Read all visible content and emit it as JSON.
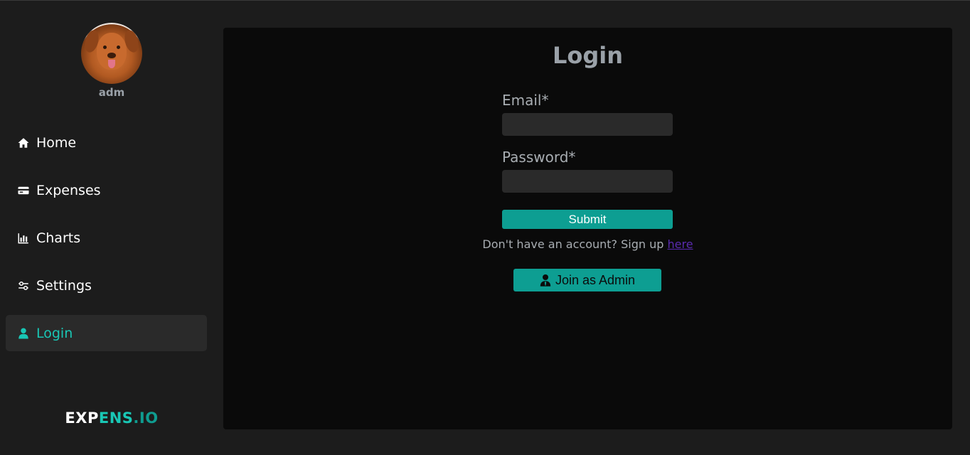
{
  "user": {
    "name": "adm"
  },
  "nav": {
    "items": [
      {
        "label": "Home",
        "icon": "home-icon"
      },
      {
        "label": "Expenses",
        "icon": "credit-card-icon"
      },
      {
        "label": "Charts",
        "icon": "bar-chart-icon"
      },
      {
        "label": "Settings",
        "icon": "sliders-icon"
      },
      {
        "label": "Login",
        "icon": "user-icon",
        "active": true
      }
    ]
  },
  "brand": {
    "part1": "EXP",
    "part2": "ENS",
    "part3": ".IO"
  },
  "login": {
    "title": "Login",
    "email_label": "Email*",
    "email_value": "",
    "password_label": "Password*",
    "password_value": "",
    "submit_label": "Submit",
    "signup_text": "Don't have an account? Sign up ",
    "signup_link": "here",
    "admin_label": "Join as Admin"
  },
  "colors": {
    "accent": "#19c7b5",
    "button": "#0d9e92",
    "link": "#5a2bb0",
    "background": "#1c1c1c",
    "panel": "#0a0a0a"
  }
}
